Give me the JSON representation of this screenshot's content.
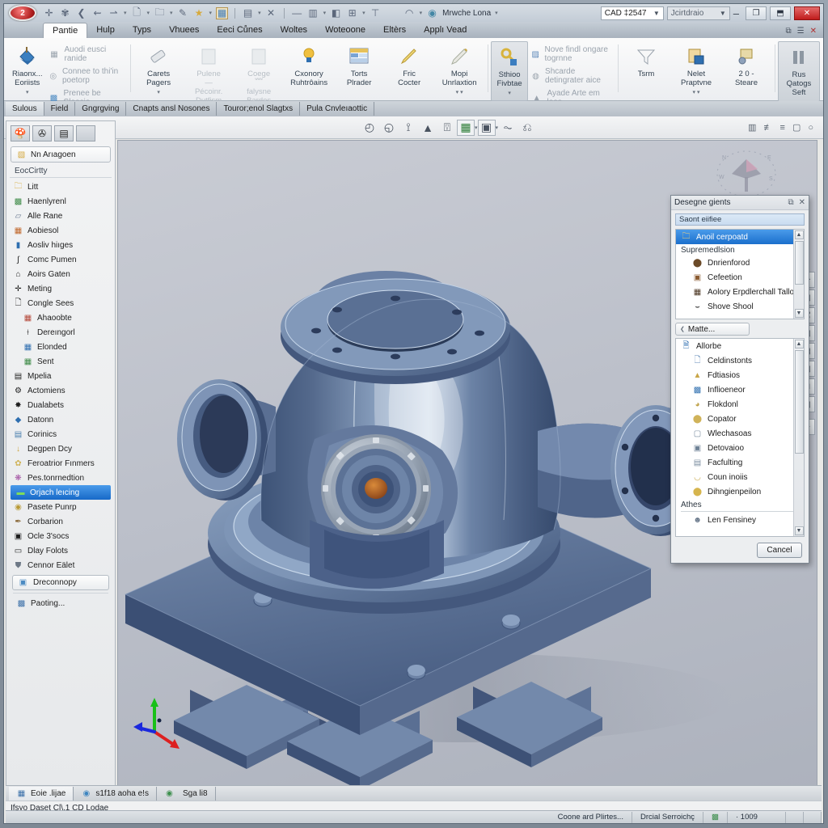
{
  "window": {
    "orb_label": "2",
    "doc_combo": "CAD ‡2547",
    "ctx_combo": "Jcirtdraio",
    "minimize": "–",
    "restore": "❐",
    "maximize": "⬒",
    "close": "✕",
    "qat_icons": [
      "new-icon",
      "assembly-icon",
      "undo-icon",
      "redo-icon",
      "measure-icon",
      "document-icon",
      "folder-icon",
      "pin-icon",
      "star-icon",
      "image-icon",
      "grid-icon",
      "close-x-icon",
      "minus-icon",
      "layers-icon",
      "paint-icon",
      "window-icon",
      "tee-icon"
    ],
    "cloud_label": "Mrwche Lona"
  },
  "ribbon": {
    "tabs": [
      {
        "label": "Pantie",
        "active": true
      },
      {
        "label": "Hulp",
        "active": false
      },
      {
        "label": "Typs",
        "active": false
      },
      {
        "label": "Vhuees",
        "active": false
      },
      {
        "label": "Eeci Cůnes",
        "active": false
      },
      {
        "label": "Woltes",
        "active": false
      },
      {
        "label": "Woteoone",
        "active": false
      },
      {
        "label": "Eltèrs",
        "active": false
      },
      {
        "label": "Applı Vead",
        "active": false
      }
    ],
    "tabs_right": [
      "⧉",
      "☰",
      "✕"
    ],
    "groups": [
      {
        "big": [
          {
            "label": "Riaonx...\nEoriists",
            "icon": "paint-bucket-icon",
            "framed": false,
            "caret": true
          }
        ],
        "small": [
          {
            "label": "Auodi eusci ranide",
            "icon": "table-icon"
          },
          {
            "label": "Connee to thi'in poetorp",
            "icon": "link-icon"
          },
          {
            "label": "Prenee be Sleecio...",
            "icon": "picture-icon"
          }
        ]
      },
      {
        "big": [
          {
            "label": "Carets\nPagers",
            "icon": "eraser-icon",
            "framed": false,
            "caret": true
          },
          {
            "label": "Pulene\n—\nPécoinr.  Dutfism",
            "icon": "page-icon",
            "framed": false,
            "caret": false
          },
          {
            "label": "Coege\n﹌\nfalysne  Bardes",
            "icon": "page2-icon",
            "framed": false,
            "caret": false
          },
          {
            "label": "Cxonory\nRuhtrôains",
            "icon": "bulb-icon",
            "framed": false,
            "caret": false
          },
          {
            "label": "Torts\nPlrader",
            "icon": "sheet-icon",
            "framed": false,
            "caret": false
          },
          {
            "label": "Fric\nCocter",
            "icon": "pen-icon",
            "framed": false,
            "caret": false
          },
          {
            "label": "Mopi\nUnrlaxtion",
            "icon": "brush-icon",
            "framed": false,
            "caret": true
          }
        ],
        "small": []
      },
      {
        "big": [
          {
            "label": "Sthioo\nFivbtae",
            "icon": "key-icon",
            "framed": true,
            "caret": true
          }
        ],
        "small": [
          {
            "label": "Nove findl ongare togrnne",
            "icon": "chart-icon"
          },
          {
            "label": "Shcarde detingrater aice",
            "icon": "badge-icon"
          },
          {
            "label": "Ayade Arte em loos",
            "icon": "cone-icon"
          }
        ]
      },
      {
        "big": [
          {
            "label": "Tsrm",
            "icon": "funnel-icon",
            "framed": false,
            "caret": false
          },
          {
            "label": "Nelet\nPraptvne",
            "icon": "note-icon",
            "framed": false,
            "caret": true
          },
          {
            "label": "2 0 -\nSteare",
            "icon": "2d-icon",
            "framed": false,
            "caret": false
          }
        ],
        "small": []
      },
      {
        "big": [
          {
            "label": "Rus\nQatogs\nSeft",
            "icon": "columns-icon",
            "framed": true,
            "caret": false
          }
        ],
        "small": []
      }
    ]
  },
  "context_tabs": [
    {
      "label": "Sulous",
      "selected": true
    },
    {
      "label": "Field",
      "selected": false
    },
    {
      "label": "Gngrgving",
      "selected": false
    },
    {
      "label": "Cnapts ansl Nosones",
      "selected": false
    },
    {
      "label": "Touror;enol Slagtxs",
      "selected": false
    },
    {
      "label": "Pula Cnvleıaottic",
      "selected": false
    }
  ],
  "toolbar": {
    "tools": [
      "orbit-icon",
      "zoom-icon",
      "section-icon",
      "cone-icon",
      "perspective-icon",
      "spreadsheet-icon",
      "box-icon",
      "filter-icon",
      "measure-icon"
    ],
    "right_tools": [
      "grid-icon",
      "align-icon",
      "list-icon",
      "frame-icon",
      "circle-icon"
    ]
  },
  "left_panel": {
    "toolbar_icons": [
      "tree-icon",
      "link-icon",
      "properties-icon",
      "blank-icon"
    ],
    "header": {
      "label": "Nn Arıagoen",
      "icon": "assembly-icon"
    },
    "section_label": "EocCirtty",
    "items": [
      {
        "label": "Litt",
        "icon": "folder-open-icon",
        "indent": false,
        "selected": false
      },
      {
        "label": "Haenlyrenl",
        "icon": "image-green-icon",
        "indent": false,
        "selected": false
      },
      {
        "label": "Alle Rane",
        "icon": "plane-icon",
        "indent": false,
        "selected": false
      },
      {
        "label": "Aobiesol",
        "icon": "picture-icon",
        "indent": false,
        "selected": false
      },
      {
        "label": "Aosliv hiıges",
        "icon": "bottle-icon",
        "indent": false,
        "selected": false
      },
      {
        "label": "Comc Pumen",
        "icon": "curve-icon",
        "indent": false,
        "selected": false
      },
      {
        "label": "Aoirs Gaten",
        "icon": "home-icon",
        "indent": false,
        "selected": false
      },
      {
        "label": "Meting",
        "icon": "cross-icon",
        "indent": false,
        "selected": false
      },
      {
        "label": "Congle Sees",
        "icon": "sheet-icon",
        "indent": false,
        "selected": false
      },
      {
        "label": "Ahaoobte",
        "icon": "grid-color-icon",
        "indent": true,
        "selected": false
      },
      {
        "label": "Dereıngorl",
        "icon": "dimension-icon",
        "indent": true,
        "selected": false
      },
      {
        "label": "Elonded",
        "icon": "table-blue-icon",
        "indent": true,
        "selected": false
      },
      {
        "label": "Sent",
        "icon": "table-green-icon",
        "indent": true,
        "selected": false
      },
      {
        "label": "Mpelia",
        "icon": "drawer-icon",
        "indent": false,
        "selected": false
      },
      {
        "label": "Actomiens",
        "icon": "gear-icon",
        "indent": false,
        "selected": false
      },
      {
        "label": "Dualabets",
        "icon": "gear2-icon",
        "indent": false,
        "selected": false
      },
      {
        "label": "Datonn",
        "icon": "diamond-icon",
        "indent": false,
        "selected": false
      },
      {
        "label": "Corinics",
        "icon": "stack-icon",
        "indent": false,
        "selected": false
      },
      {
        "label": "Degpen Dcy",
        "icon": "arrow-down-icon",
        "indent": false,
        "selected": false
      },
      {
        "label": "Feroatrior Fınmers",
        "icon": "flower-icon",
        "indent": false,
        "selected": false
      },
      {
        "label": "Pes.tonrnedtion",
        "icon": "confetti-icon",
        "indent": false,
        "selected": false
      },
      {
        "label": "Orjach leıcing",
        "icon": "sofa-icon",
        "indent": false,
        "selected": true
      },
      {
        "label": "Pasete Punrp",
        "icon": "pump-icon",
        "indent": false,
        "selected": false
      },
      {
        "label": "Corbarion",
        "icon": "feather-icon",
        "indent": false,
        "selected": false
      },
      {
        "label": "Ocle 3'socs",
        "icon": "camera-icon",
        "indent": false,
        "selected": false
      },
      {
        "label": "Dlay Folots",
        "icon": "window-icon",
        "indent": false,
        "selected": false
      },
      {
        "label": "Cennor Eälet",
        "icon": "shield-icon",
        "indent": false,
        "selected": false
      }
    ],
    "button": {
      "label": "Dreconnopy",
      "icon": "monitor-icon"
    },
    "footer": {
      "label": "Paoting...",
      "icon": "pattern-icon"
    },
    "scroll": {
      "left": "◀",
      "right": "▶",
      "thumb": "0"
    }
  },
  "viewport": {
    "model_name": "blue-valve-pump-assembly",
    "axis": {
      "x": "X",
      "y": "Y",
      "z": "Z",
      "x_color": "#dd2020",
      "y_color": "#18c018",
      "z_color": "#1a28dd"
    },
    "background_color": "#b8bcc8",
    "model_color": "#5b7396",
    "side_toolbar": [
      "pan-icon",
      "zoom-window-icon",
      "zoom-fit-icon",
      "zoom-previous-icon",
      "render-icon",
      "shade-icon",
      "wire-icon",
      "material-icon",
      "light-icon"
    ]
  },
  "dialog": {
    "title": "Desegne gients",
    "title_buttons": [
      "restore-icon",
      "close-icon"
    ],
    "search_value": "Saont eiifiee",
    "list_top": [
      {
        "label": "Anoil cerpoatd",
        "icon": "folder-icon",
        "selected": true,
        "indent": false
      },
      {
        "label": "Supremedlsion",
        "icon": "",
        "selected": false,
        "group": true
      },
      {
        "label": "Dnrienforod",
        "icon": "sphere-brown-icon",
        "selected": false,
        "indent": true
      },
      {
        "label": "Cefeetion",
        "icon": "swatch-brown-icon",
        "selected": false,
        "indent": true
      },
      {
        "label": "Aolory Erpdlerchall Tallor",
        "icon": "swatch-dark-icon",
        "selected": false,
        "indent": true
      },
      {
        "label": "Shove Shool",
        "icon": "curve-icon",
        "selected": false,
        "indent": true
      }
    ],
    "more_button": "Matte...",
    "list_bottom": [
      {
        "label": "Allorbe",
        "icon": "lock-doc-icon",
        "indent": false
      },
      {
        "label": "Celdinstonts",
        "icon": "page-blue-icon",
        "indent": true
      },
      {
        "label": "Fdtiasios",
        "icon": "cone-gold-icon",
        "indent": true
      },
      {
        "label": "Inflioeneor",
        "icon": "image-icon",
        "indent": true
      },
      {
        "label": "Flokdonl",
        "icon": "pie-icon",
        "indent": true
      },
      {
        "label": "Copator",
        "icon": "sphere-gold-icon",
        "indent": true
      },
      {
        "label": "Wlechasoas",
        "icon": "frame-icon",
        "indent": true
      },
      {
        "label": "Detovaioo",
        "icon": "frame2-icon",
        "indent": true
      },
      {
        "label": "Facfulting",
        "icon": "frame3-icon",
        "indent": true
      },
      {
        "label": "Coun inoiis",
        "icon": "cup-icon",
        "indent": true
      },
      {
        "label": "Dihngienpeilon",
        "icon": "gold-icon",
        "indent": true
      },
      {
        "label": "Athes",
        "group": true,
        "icon": ""
      },
      {
        "label": "Len Fensiney",
        "icon": "person-icon",
        "indent": true
      }
    ],
    "cancel_label": "Cancel"
  },
  "doc_tabs": [
    {
      "label": "Eoie .lijae",
      "icon": "model-icon",
      "active": true
    },
    {
      "label": "s1f18 aoha e!s",
      "icon": "earth-icon",
      "active": false
    },
    {
      "label": "Sga li8",
      "icon": "globe-green-icon",
      "active": false
    }
  ],
  "command_line": "Ifsyo Daset Cl\\,1 CD Lodae",
  "status": {
    "cells": [
      "Coone ard Plirtes...",
      "Drcial Serroichç",
      "",
      "·  1009"
    ],
    "icon": "status-icon"
  }
}
